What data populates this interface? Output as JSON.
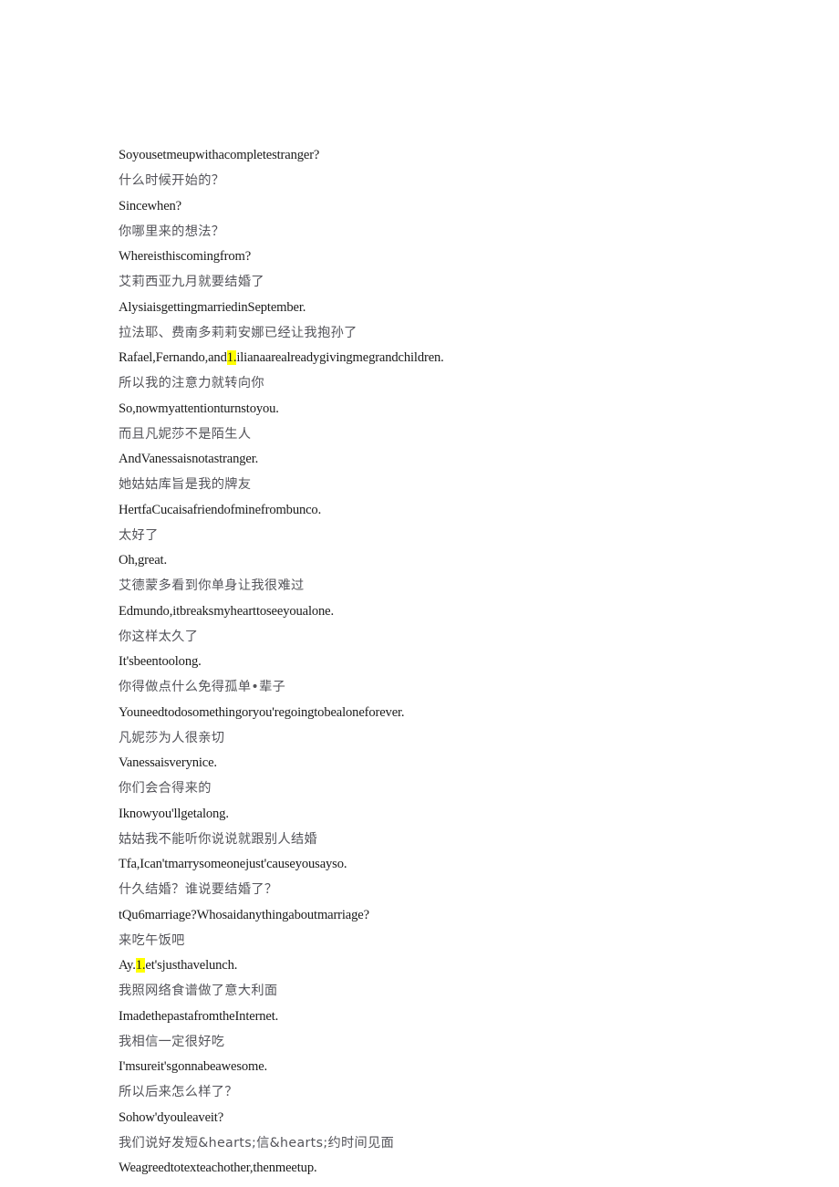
{
  "document": {
    "page_background": "#ffffff",
    "text_color_english": "#1a1a1a",
    "text_color_chinese": "#54545a",
    "highlight_color": "#ffff00",
    "lines": [
      {
        "lang": "en",
        "text": "Soyousetmeupwithacompletestranger?"
      },
      {
        "lang": "zh",
        "text": "什么时候开始的？"
      },
      {
        "lang": "en",
        "text": "Sincewhen?"
      },
      {
        "lang": "zh",
        "text": "你哪里来的想法？"
      },
      {
        "lang": "en",
        "text": "Whereisthiscomingfrom?"
      },
      {
        "lang": "zh",
        "text": "艾莉西亚九月就要结婚了"
      },
      {
        "lang": "en",
        "text": "AlysiaisgettingmarriedinSeptember."
      },
      {
        "lang": "zh",
        "text": "拉法耶、费南多莉莉安娜已经让我抱孙了"
      },
      {
        "lang": "en",
        "segments": [
          {
            "text": "Rafael,Fernando,and",
            "highlight": false
          },
          {
            "text": "1.",
            "highlight": true
          },
          {
            "text": "ilianaarealreadygivingmegrandchildren.",
            "highlight": false
          }
        ],
        "text": "Rafael,Fernando,and1.ilianaarealreadygivingmegrandchildren."
      },
      {
        "lang": "zh",
        "text": "所以我的注意力就转向你"
      },
      {
        "lang": "en",
        "text": "So,nowmyattentionturnstoyou."
      },
      {
        "lang": "zh",
        "text": "而且凡妮莎不是陌生人"
      },
      {
        "lang": "en",
        "text": "AndVanessaisnotastranger."
      },
      {
        "lang": "zh",
        "text": "她姑姑库旨是我的牌友"
      },
      {
        "lang": "en",
        "text": "HertfaCucaisafriendofminefrombunco."
      },
      {
        "lang": "zh",
        "text": "太好了"
      },
      {
        "lang": "en",
        "text": "Oh,great."
      },
      {
        "lang": "zh",
        "text": "艾德蒙多看到你单身让我很难过"
      },
      {
        "lang": "en",
        "text": "Edmundo,itbreaksmyhearttoseeyoualone."
      },
      {
        "lang": "zh",
        "text": "你这样太久了"
      },
      {
        "lang": "en",
        "text": "It'sbeentoolong."
      },
      {
        "lang": "zh",
        "text": "你得做点什么免得孤单•辈子"
      },
      {
        "lang": "en",
        "text": "Youneedtodosomethingoryou'regoingtobealoneforever."
      },
      {
        "lang": "zh",
        "text": "凡妮莎为人很亲切"
      },
      {
        "lang": "en",
        "text": "Vanessaisverynice."
      },
      {
        "lang": "zh",
        "text": "你们会合得来的"
      },
      {
        "lang": "en",
        "text": "Iknowyou'llgetalong."
      },
      {
        "lang": "zh",
        "text": "姑姑我不能听你说说就跟别人结婚"
      },
      {
        "lang": "en",
        "text": "Tfa,Ican'tmarrysomeonejust'causeyousayso."
      },
      {
        "lang": "zh",
        "text": "什久结婚？谁说要结婚了？"
      },
      {
        "lang": "en",
        "text": "tQu6marriage?Whosaidanythingaboutmarriage?"
      },
      {
        "lang": "zh",
        "text": "来吃午饭吧"
      },
      {
        "lang": "en",
        "segments": [
          {
            "text": "Ay.",
            "highlight": false
          },
          {
            "text": "1.",
            "highlight": true
          },
          {
            "text": "et'sjusthavelunch.",
            "highlight": false
          }
        ],
        "text": "Ay.1.et'sjusthavelunch."
      },
      {
        "lang": "zh",
        "text": "我照网络食谱做了意大利面"
      },
      {
        "lang": "en",
        "text": "ImadethepastafromtheInternet."
      },
      {
        "lang": "zh",
        "text": "我相信一定很好吃"
      },
      {
        "lang": "en",
        "text": "I'msureit'sgonnabeawesome."
      },
      {
        "lang": "zh",
        "text": "所以后来怎么样了？"
      },
      {
        "lang": "en",
        "text": "Sohow'dyouleaveit?"
      },
      {
        "lang": "zh",
        "text": "我们说好发短&hearts;信&hearts;约时间见面"
      },
      {
        "lang": "en",
        "text": "Weagreedtotexteachother,thenmeetup."
      }
    ]
  }
}
